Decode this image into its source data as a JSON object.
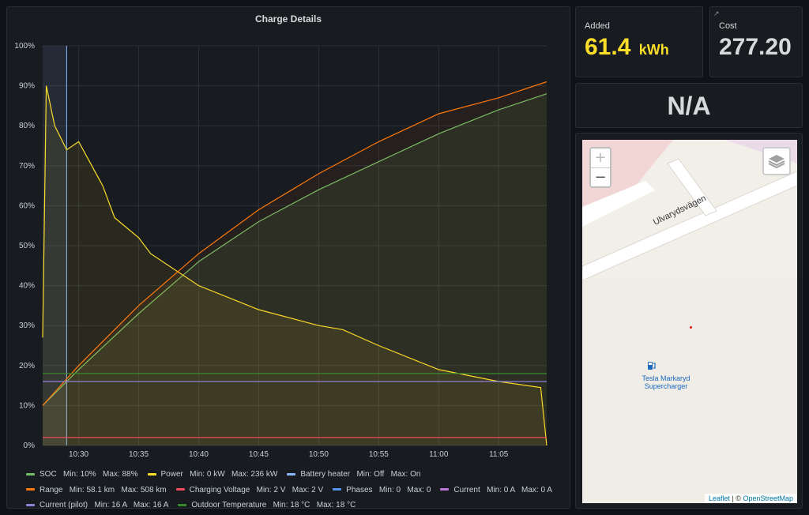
{
  "chart_panel": {
    "title": "Charge Details"
  },
  "chart_data": {
    "type": "line",
    "title": "Charge Details",
    "x_ticks": [
      "10:30",
      "10:35",
      "10:40",
      "10:45",
      "10:50",
      "10:55",
      "11:00",
      "11:05"
    ],
    "x_range": [
      "10:27",
      "11:09"
    ],
    "y_ticks": [
      "0%",
      "10%",
      "20%",
      "30%",
      "40%",
      "50%",
      "60%",
      "70%",
      "80%",
      "90%",
      "100%"
    ],
    "ylim": [
      0,
      100
    ],
    "y_unit": "%",
    "grid": true,
    "legend_position": "bottom",
    "series": [
      {
        "name": "SOC",
        "color": "#73bf69",
        "min": "10%",
        "max": "88%",
        "x": [
          "10:27",
          "10:30",
          "10:35",
          "10:40",
          "10:45",
          "10:50",
          "10:55",
          "11:00",
          "11:05",
          "11:09"
        ],
        "values": [
          10,
          19,
          33,
          46,
          56,
          64,
          71,
          78,
          84,
          88
        ]
      },
      {
        "name": "Power",
        "color": "#fade2a",
        "min": "0 kW",
        "max": "236 kW",
        "x": [
          "10:27",
          "10:27.3",
          "10:28",
          "10:29",
          "10:30",
          "10:32",
          "10:33",
          "10:35",
          "10:36",
          "10:40",
          "10:45",
          "10:50",
          "10:52",
          "10:55",
          "11:00",
          "11:05",
          "11:08.5",
          "11:09"
        ],
        "values": [
          27,
          90,
          80,
          74,
          76,
          65,
          57,
          52,
          48,
          40,
          34,
          30,
          29,
          25,
          19,
          16,
          14.5,
          0
        ]
      },
      {
        "name": "Battery heater",
        "color": "#8ab8ff",
        "min": "Off",
        "max": "On"
      },
      {
        "name": "Range",
        "color": "#ff780a",
        "min": "58.1 km",
        "max": "508 km",
        "x": [
          "10:27",
          "10:30",
          "10:35",
          "10:40",
          "10:45",
          "10:50",
          "10:55",
          "11:00",
          "11:05",
          "11:09"
        ],
        "values": [
          10,
          20,
          35,
          48,
          59,
          68,
          76,
          83,
          87,
          91
        ]
      },
      {
        "name": "Charging Voltage",
        "color": "#f2495c",
        "min": "2 V",
        "max": "2 V",
        "x": [
          "10:27",
          "11:09"
        ],
        "values": [
          2,
          2
        ]
      },
      {
        "name": "Phases",
        "color": "#5794f2",
        "min": "0",
        "max": "0"
      },
      {
        "name": "Current",
        "color": "#b877d9",
        "min": "0 A",
        "max": "0 A"
      },
      {
        "name": "Current (pilot)",
        "color": "#8f80d8",
        "min": "16 A",
        "max": "16 A",
        "x": [
          "10:27",
          "11:09"
        ],
        "values": [
          16,
          16
        ]
      },
      {
        "name": "Outdoor Temperature",
        "color": "#37872d",
        "min": "18 °C",
        "max": "18 °C",
        "x": [
          "10:27",
          "11:09"
        ],
        "values": [
          18,
          18
        ]
      }
    ],
    "legend_labels": {
      "min": "Min:",
      "max": "Max:"
    }
  },
  "added_panel": {
    "label": "Added",
    "value": "61.4",
    "unit": "kWh",
    "color": "#fade2a"
  },
  "cost_panel": {
    "label": "Cost",
    "value": "277.20",
    "color": "#d8d9da",
    "icon": "external-link-icon"
  },
  "status_panel": {
    "value": "N/A"
  },
  "map_panel": {
    "street": "Ulvarydsvägen",
    "poi_line1": "Tesla Markaryd",
    "poi_line2": "Supercharger",
    "zoom_in": "+",
    "zoom_out": "−",
    "attribution_leaflet": "Leaflet",
    "attribution_sep": " | © ",
    "attribution_osm": "OpenStreetMap"
  }
}
